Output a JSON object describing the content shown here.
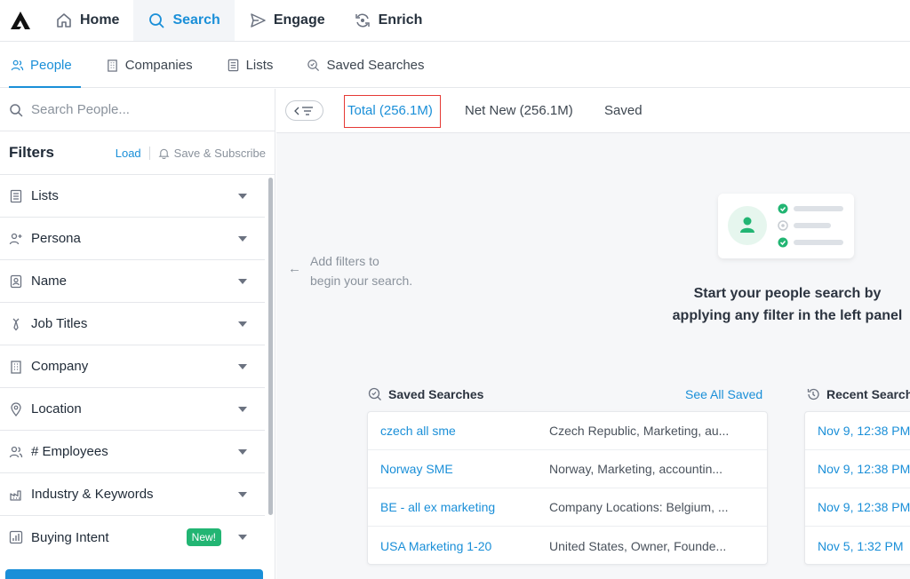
{
  "topnav": {
    "items": [
      {
        "label": "Home",
        "icon": "home-icon"
      },
      {
        "label": "Search",
        "icon": "search-icon",
        "active": true
      },
      {
        "label": "Engage",
        "icon": "send-icon"
      },
      {
        "label": "Enrich",
        "icon": "refresh-icon"
      }
    ]
  },
  "subnav": {
    "items": [
      {
        "label": "People",
        "icon": "people-icon",
        "active": true
      },
      {
        "label": "Companies",
        "icon": "building-icon"
      },
      {
        "label": "Lists",
        "icon": "list-icon"
      },
      {
        "label": "Saved Searches",
        "icon": "saved-search-icon"
      }
    ]
  },
  "sidebar": {
    "search_placeholder": "Search People...",
    "filters_title": "Filters",
    "load_label": "Load",
    "save_subscribe_label": "Save & Subscribe",
    "filters": [
      {
        "label": "Lists",
        "icon": "list-icon"
      },
      {
        "label": "Persona",
        "icon": "persona-icon"
      },
      {
        "label": "Name",
        "icon": "id-card-icon"
      },
      {
        "label": "Job Titles",
        "icon": "tie-icon"
      },
      {
        "label": "Company",
        "icon": "building-icon"
      },
      {
        "label": "Location",
        "icon": "location-pin-icon"
      },
      {
        "label": "# Employees",
        "icon": "people-icon"
      },
      {
        "label": "Industry & Keywords",
        "icon": "factory-icon"
      },
      {
        "label": "Buying Intent",
        "icon": "bar-chart-icon",
        "badge": "New!"
      }
    ]
  },
  "tabs": {
    "total": "Total (256.1M)",
    "net_new": "Net New (256.1M)",
    "saved": "Saved"
  },
  "empty_state": {
    "hint_line1": "Add filters to",
    "hint_line2": "begin your search.",
    "prompt_line1": "Start your people search by",
    "prompt_line2": "applying any filter in the left panel"
  },
  "saved_searches": {
    "title": "Saved Searches",
    "see_all": "See All Saved",
    "rows": [
      {
        "name": "czech all sme",
        "desc": "Czech Republic, Marketing, au..."
      },
      {
        "name": "Norway SME",
        "desc": "Norway, Marketing, accountin..."
      },
      {
        "name": "BE - all ex marketing",
        "desc": "Company Locations: Belgium, ..."
      },
      {
        "name": "USA Marketing 1-20",
        "desc": "United States, Owner, Founde..."
      }
    ]
  },
  "recent_searches": {
    "title": "Recent Searches",
    "rows": [
      {
        "date": "Nov 9, 12:38 PM"
      },
      {
        "date": "Nov 9, 12:38 PM"
      },
      {
        "date": "Nov 9, 12:38 PM"
      },
      {
        "date": "Nov 5, 1:32 PM"
      }
    ]
  },
  "colors": {
    "accent": "#1a8fd8",
    "success": "#22b573",
    "highlight_box": "#e53935"
  }
}
